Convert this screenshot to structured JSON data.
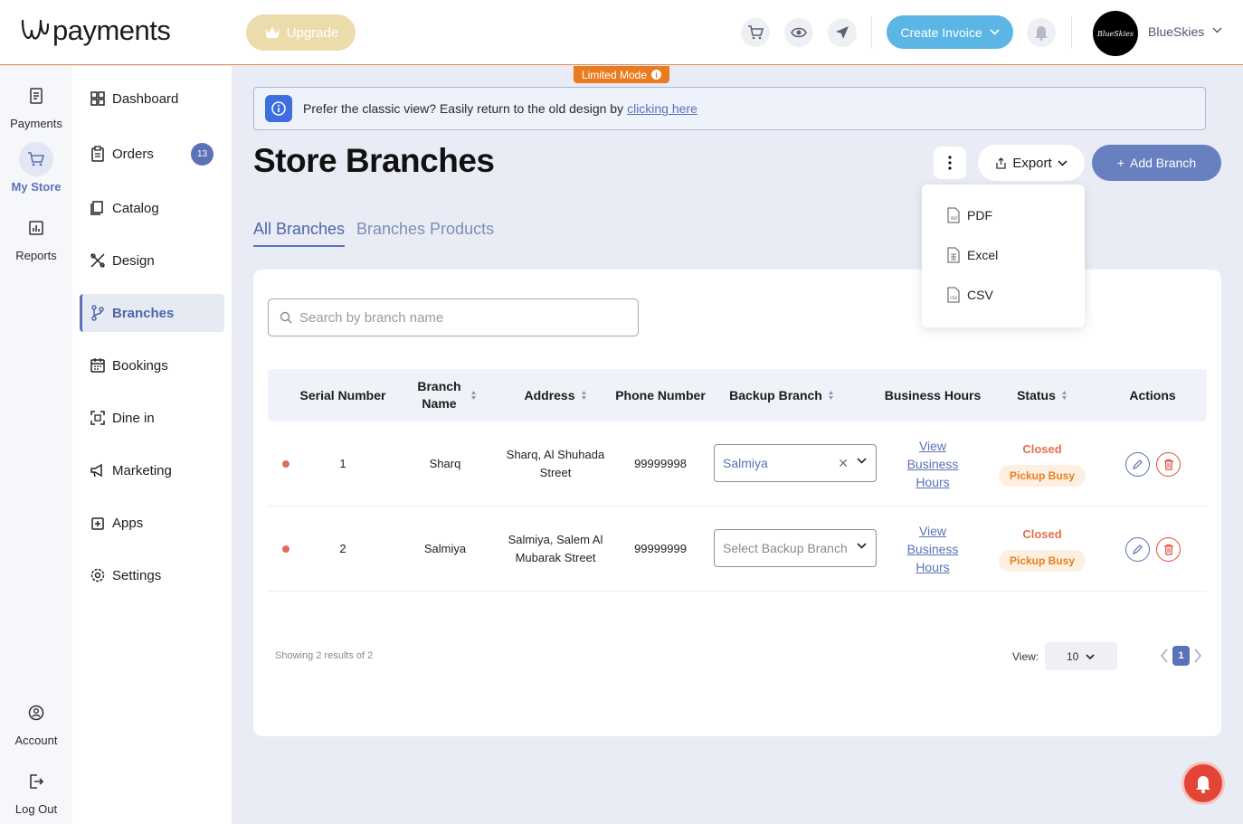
{
  "brand": {
    "logo_text": "payments"
  },
  "topbar": {
    "upgrade_label": "Upgrade",
    "create_invoice_label": "Create Invoice",
    "avatar_text": "BlueSkies",
    "user_name": "BlueSkies",
    "accent": "#5bb6e5",
    "upgrade_color": "#ecdcab"
  },
  "rail": {
    "items": [
      {
        "label": "Payments",
        "icon": "document-icon"
      },
      {
        "label": "My Store",
        "icon": "cart-icon",
        "active": true
      },
      {
        "label": "Reports",
        "icon": "chart-icon"
      },
      {
        "label": "Account",
        "icon": "account-icon"
      },
      {
        "label": "Log Out",
        "icon": "logout-icon"
      }
    ]
  },
  "sidebar": {
    "items": [
      {
        "label": "Dashboard",
        "icon": "grid-icon"
      },
      {
        "label": "Orders",
        "icon": "clipboard-icon",
        "badge": "13"
      },
      {
        "label": "Catalog",
        "icon": "catalog-icon"
      },
      {
        "label": "Design",
        "icon": "design-icon"
      },
      {
        "label": "Branches",
        "icon": "branch-icon",
        "active": true
      },
      {
        "label": "Bookings",
        "icon": "calendar-icon"
      },
      {
        "label": "Dine in",
        "icon": "qr-icon"
      },
      {
        "label": "Marketing",
        "icon": "megaphone-icon"
      },
      {
        "label": "Apps",
        "icon": "apps-icon"
      },
      {
        "label": "Settings",
        "icon": "gear-icon"
      }
    ]
  },
  "limited_mode": {
    "label": "Limited Mode",
    "info": "i"
  },
  "banner": {
    "text": "Prefer the classic view? Easily return to the old design by",
    "link": "clicking here"
  },
  "page": {
    "title": "Store Branches",
    "export_label": "Export",
    "add_branch_label": "Add Branch",
    "add_branch_prefix": "+",
    "tabs": [
      {
        "label": "All Branches",
        "active": true
      },
      {
        "label": "Branches Products",
        "active": false
      }
    ]
  },
  "export_menu": {
    "items": [
      {
        "label": "PDF",
        "icon": "pdf-file-icon"
      },
      {
        "label": "Excel",
        "icon": "excel-file-icon"
      },
      {
        "label": "CSV",
        "icon": "csv-file-icon"
      }
    ]
  },
  "search": {
    "placeholder": "Search by branch name",
    "value": ""
  },
  "table": {
    "columns": [
      "Serial Number",
      "Branch Name",
      "Address",
      "Phone Number",
      "Backup Branch",
      "Business Hours",
      "Status",
      "Actions"
    ],
    "rows": [
      {
        "serial": "1",
        "branch": "Sharq",
        "address": "Sharq, Al Shuhada Street",
        "phone": "99999998",
        "backup_value": "Salmiya",
        "backup_placeholder": "",
        "business_hours": "View Business Hours",
        "status": "Closed",
        "substatus": "Pickup Busy"
      },
      {
        "serial": "2",
        "branch": "Salmiya",
        "address": "Salmiya, Salem Al Mubarak Street",
        "phone": "99999999",
        "backup_value": "",
        "backup_placeholder": "Select Backup Branch",
        "business_hours": "View Business Hours",
        "status": "Closed",
        "substatus": "Pickup Busy"
      }
    ]
  },
  "footer": {
    "showing": "Showing 2 results of 2",
    "view_label": "View:",
    "page_size": "10",
    "current_page": "1"
  },
  "colors": {
    "primary": "#5a72b7",
    "status_closed": "#e5704f",
    "pickup_busy": "#e57f1e",
    "limited_mode": "#ea7b20"
  }
}
